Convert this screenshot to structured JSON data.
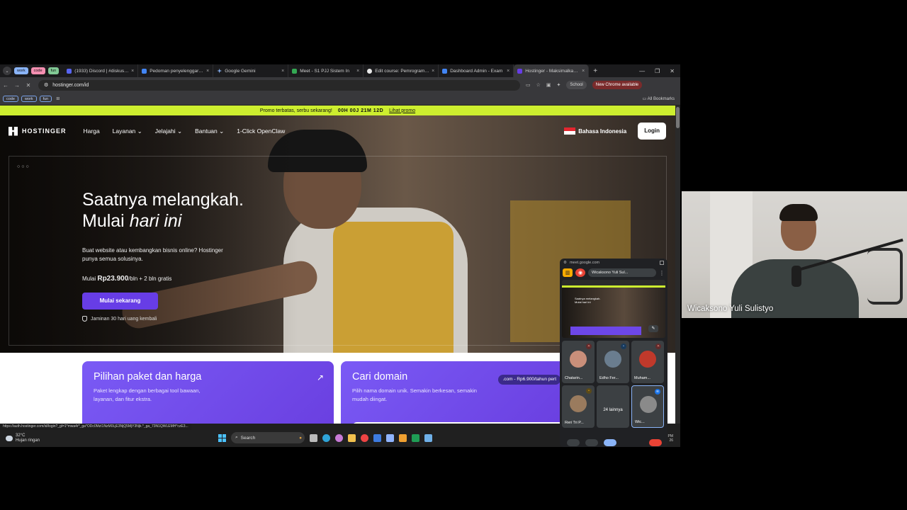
{
  "browser": {
    "tab_groups": [
      {
        "label": "work",
        "color": "#8ab4f8"
      },
      {
        "label": "code",
        "color": "#f48fb1"
      },
      {
        "label": "fun",
        "color": "#81c995"
      }
    ],
    "tabs": [
      {
        "title": "(1933) Discord | #diskusi_p",
        "color": "#5865f2"
      },
      {
        "title": "Pedoman penyelenggaraan",
        "color": "#4285f4"
      },
      {
        "title": "Google Gemini",
        "color": "#8ab4f8"
      },
      {
        "title": "Meet - S1 PJJ Sistem In",
        "color": "#34a853"
      },
      {
        "title": "Edit course: Pemrograman",
        "color": "#e8e8e8"
      },
      {
        "title": "Dashboard Admin - Exam",
        "color": "#4285f4"
      },
      {
        "title": "Hostinger - Maksimalkan p",
        "color": "#673de6"
      }
    ],
    "url": "hostinger.com/id",
    "school_label": "School",
    "new_chrome_label": "New Chrome available",
    "bookmark_chips": [
      "code",
      "work",
      "fun"
    ],
    "all_bookmarks": "All Bookmarks",
    "status_url": "https://auth.hostinger.com/id/login?_gl=1*mwa4r*_ga*ODc0MzI1NzM0LjE3NjQ5MjY3Njk.*_ga_73N1QWLEMH*czE3..."
  },
  "site": {
    "promo": {
      "text": "Promo terbatas, serbu sekarang!",
      "timer": "00H 00J 21M 12D",
      "link": "Lihat promo"
    },
    "brand": "HOSTINGER",
    "nav": [
      "Harga",
      "Layanan ⌄",
      "Jelajahi ⌄",
      "Bantuan ⌄",
      "1-Click OpenClaw"
    ],
    "language": "Bahasa Indonesia",
    "login": "Login",
    "hero": {
      "dots": "○○○",
      "title_line1": "Saatnya melangkah.",
      "title_line2_prefix": "Mulai ",
      "title_line2_italic": "hari ini",
      "subtitle": "Buat website atau kembangkan bisnis online? Hostinger punya semua solusinya.",
      "price_prefix": "Mulai ",
      "price_value": "Rp23.900",
      "price_suffix": "/bln + 2 bln gratis",
      "cta": "Mulai sekarang",
      "guarantee": "Jaminan 30 hari uang kembali"
    },
    "cards": [
      {
        "title": "Pilihan paket dan harga",
        "text": "Paket lengkap dengan berbagai tool bawaan, layanan, dan fitur ekstra.",
        "arrow": "↗"
      },
      {
        "title": "Cari domain",
        "text": "Pilih nama domain unik. Semakin berkesan, semakin mudah diingat.",
        "pill": ".com - Rp6.900/tahun pert"
      }
    ]
  },
  "taskbar": {
    "temp": "32°C",
    "weather": "Hujan ringan",
    "search": "Search",
    "time": "PM",
    "date": "26"
  },
  "meet_pip": {
    "domain": "meet.google.com",
    "presenter": "Wicaksono Yuli Sul...",
    "preview_title": "Saatnya melangkah. Mulai hari ini",
    "tiles": [
      {
        "name": "Chatarin...",
        "color": "#c98f7a"
      },
      {
        "name": "Edho Fer...",
        "color": "#6a7d8f"
      },
      {
        "name": "Muham...",
        "color": "#c0392b"
      },
      {
        "name": "Reri Tri P...",
        "color": "#9a7b5e"
      },
      {
        "name": "24 lainnya",
        "color": "#3c4043"
      },
      {
        "name": "Wic...",
        "color": "#8a8a8a"
      }
    ]
  },
  "webcam": {
    "name": "Wicaksono Yuli Sulistyo"
  }
}
